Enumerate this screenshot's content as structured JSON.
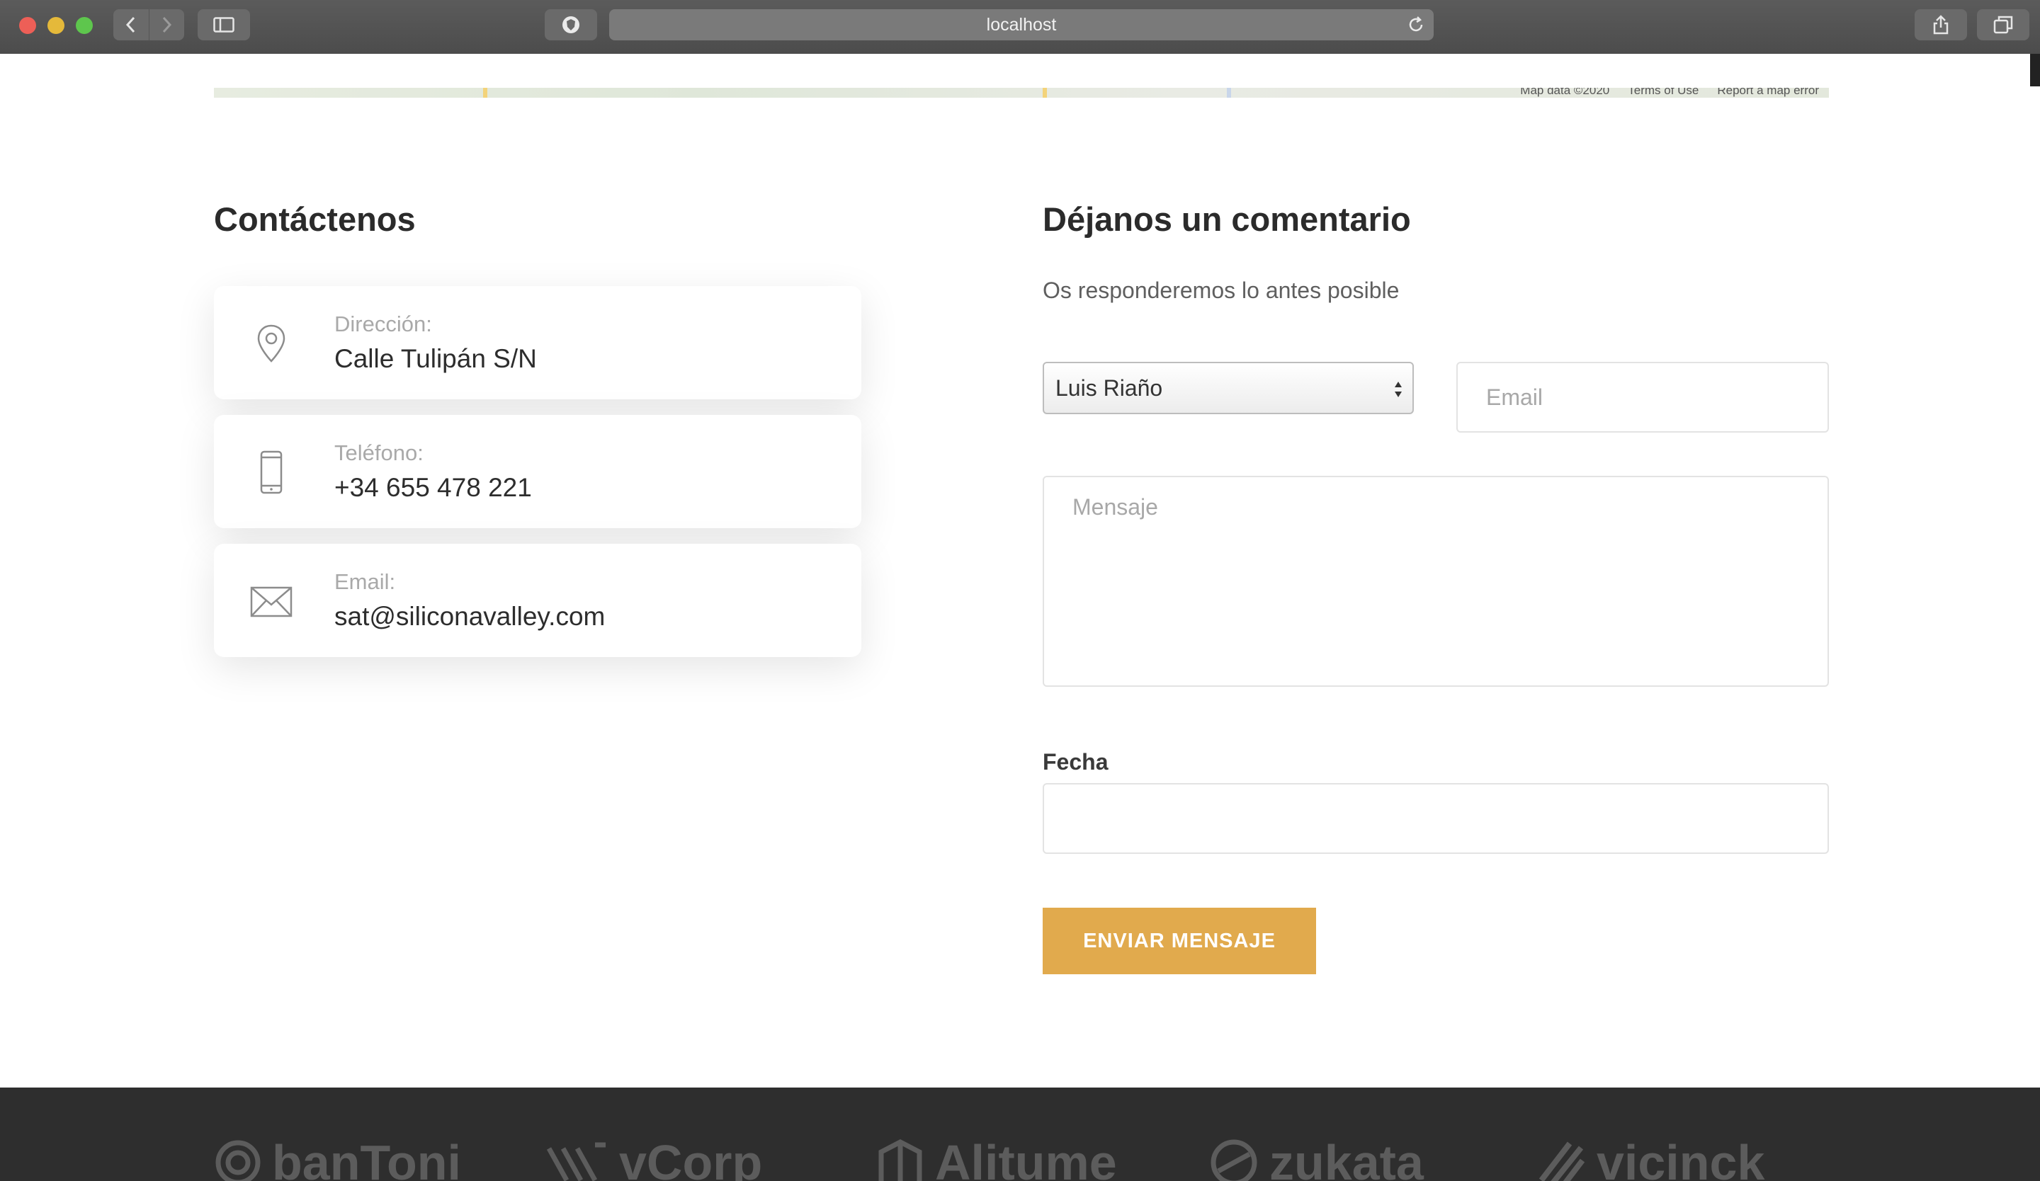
{
  "browser": {
    "url": "localhost"
  },
  "map": {
    "credits": [
      "Map data ©2020",
      "Terms of Use",
      "Report a map error"
    ]
  },
  "contact": {
    "title": "Contáctenos",
    "cards": [
      {
        "icon": "map-pin-icon",
        "label": "Dirección:",
        "value": "Calle Tulipán S/N"
      },
      {
        "icon": "phone-icon",
        "label": "Teléfono:",
        "value": "+34 655 478 221"
      },
      {
        "icon": "envelope-icon",
        "label": "Email:",
        "value": "sat@siliconavalley.com"
      }
    ]
  },
  "comment_form": {
    "title": "Déjanos un comentario",
    "subtitle": "Os responderemos lo antes posible",
    "name_select_value": "Luis Riaño",
    "email_placeholder": "Email",
    "message_placeholder": "Mensaje",
    "date_label": "Fecha",
    "submit_label": "ENVIAR MENSAJE"
  },
  "footer": {
    "brand_logos": [
      "banToni",
      "vCorp",
      "Alitume",
      "zukata",
      "vicinck"
    ]
  }
}
